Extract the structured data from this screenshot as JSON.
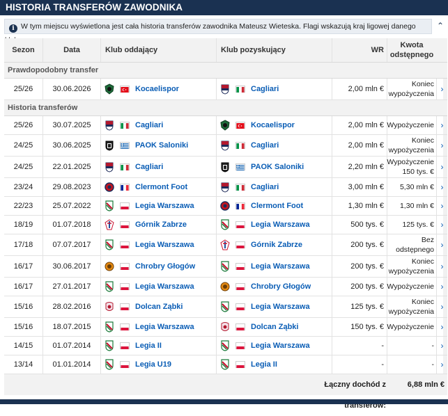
{
  "header": {
    "title": "HISTORIA TRANSFERÓW ZAWODNIKA"
  },
  "info": {
    "text": "W tym miejscu wyświetlona jest cała historia transferów zawodnika Mateusz Wieteska. Flagi wskazują kraj ligowej danego klubu."
  },
  "columns": {
    "season": "Sezon",
    "date": "Data",
    "from": "Klub oddający",
    "to": "Klub pozyskujący",
    "wr": "WR",
    "fee": "Kwota odstępnego"
  },
  "sections": {
    "probable": "Prawdopodobny transfer",
    "history": "Historia transferów"
  },
  "probable": [
    {
      "season": "25/26",
      "date": "30.06.2026",
      "from": "Kocaelispor",
      "from_crest": "kocaelispor",
      "from_flag": "turkey",
      "to": "Cagliari",
      "to_crest": "cagliari",
      "to_flag": "italy",
      "wr": "2,00 mln €",
      "fee": "Koniec wypożyczenia"
    }
  ],
  "history": [
    {
      "season": "25/26",
      "date": "30.07.2025",
      "from": "Cagliari",
      "from_crest": "cagliari",
      "from_flag": "italy",
      "to": "Kocaelispor",
      "to_crest": "kocaelispor",
      "to_flag": "turkey",
      "wr": "2,00 mln €",
      "fee": "Wypożyczenie"
    },
    {
      "season": "24/25",
      "date": "30.06.2025",
      "from": "PAOK Saloniki",
      "from_crest": "paok",
      "from_flag": "greece",
      "to": "Cagliari",
      "to_crest": "cagliari",
      "to_flag": "italy",
      "wr": "2,00 mln €",
      "fee": "Koniec wypożyczenia"
    },
    {
      "season": "24/25",
      "date": "22.01.2025",
      "from": "Cagliari",
      "from_crest": "cagliari",
      "from_flag": "italy",
      "to": "PAOK Saloniki",
      "to_crest": "paok",
      "to_flag": "greece",
      "wr": "2,20 mln €",
      "fee": "Wypożyczenie 150 tys. €"
    },
    {
      "season": "23/24",
      "date": "29.08.2023",
      "from": "Clermont Foot",
      "from_crest": "clermont",
      "from_flag": "france",
      "to": "Cagliari",
      "to_crest": "cagliari",
      "to_flag": "italy",
      "wr": "3,00 mln €",
      "fee": "5,30 mln €"
    },
    {
      "season": "22/23",
      "date": "25.07.2022",
      "from": "Legia Warszawa",
      "from_crest": "legia",
      "from_flag": "poland",
      "to": "Clermont Foot",
      "to_crest": "clermont",
      "to_flag": "france",
      "wr": "1,30 mln €",
      "fee": "1,30 mln €"
    },
    {
      "season": "18/19",
      "date": "01.07.2018",
      "from": "Górnik Zabrze",
      "from_crest": "gornik",
      "from_flag": "poland",
      "to": "Legia Warszawa",
      "to_crest": "legia",
      "to_flag": "poland",
      "wr": "500 tys. €",
      "fee": "125 tys. €"
    },
    {
      "season": "17/18",
      "date": "07.07.2017",
      "from": "Legia Warszawa",
      "from_crest": "legia",
      "from_flag": "poland",
      "to": "Górnik Zabrze",
      "to_crest": "gornik",
      "to_flag": "poland",
      "wr": "200 tys. €",
      "fee": "Bez odstępnego"
    },
    {
      "season": "16/17",
      "date": "30.06.2017",
      "from": "Chrobry Głogów",
      "from_crest": "chrobry",
      "from_flag": "poland",
      "to": "Legia Warszawa",
      "to_crest": "legia",
      "to_flag": "poland",
      "wr": "200 tys. €",
      "fee": "Koniec wypożyczenia"
    },
    {
      "season": "16/17",
      "date": "27.01.2017",
      "from": "Legia Warszawa",
      "from_crest": "legia",
      "from_flag": "poland",
      "to": "Chrobry Głogów",
      "to_crest": "chrobry",
      "to_flag": "poland",
      "wr": "200 tys. €",
      "fee": "Wypożyczenie"
    },
    {
      "season": "15/16",
      "date": "28.02.2016",
      "from": "Dolcan Ząbki",
      "from_crest": "dolcan",
      "from_flag": "poland",
      "to": "Legia Warszawa",
      "to_crest": "legia",
      "to_flag": "poland",
      "wr": "125 tys. €",
      "fee": "Koniec wypożyczenia"
    },
    {
      "season": "15/16",
      "date": "18.07.2015",
      "from": "Legia Warszawa",
      "from_crest": "legia",
      "from_flag": "poland",
      "to": "Dolcan Ząbki",
      "to_crest": "dolcan",
      "to_flag": "poland",
      "wr": "150 tys. €",
      "fee": "Wypożyczenie"
    },
    {
      "season": "14/15",
      "date": "01.07.2014",
      "from": "Legia II",
      "from_crest": "legia",
      "from_flag": "poland",
      "to": "Legia Warszawa",
      "to_crest": "legia",
      "to_flag": "poland",
      "wr": "-",
      "fee": "-"
    },
    {
      "season": "13/14",
      "date": "01.01.2014",
      "from": "Legia U19",
      "from_crest": "legia",
      "from_flag": "poland",
      "to": "Legia II",
      "to_crest": "legia",
      "to_flag": "poland",
      "wr": "-",
      "fee": "-"
    }
  ],
  "summary": {
    "label": "Łączny dochód z transferów:",
    "total": "6,88 mln €"
  },
  "icons": {
    "info": "info-icon",
    "collapse": "chevron-up-icon",
    "row_arrow": "chevron-right-icon"
  },
  "colors": {
    "header_bg": "#1a3151",
    "link": "#0a5db5"
  }
}
